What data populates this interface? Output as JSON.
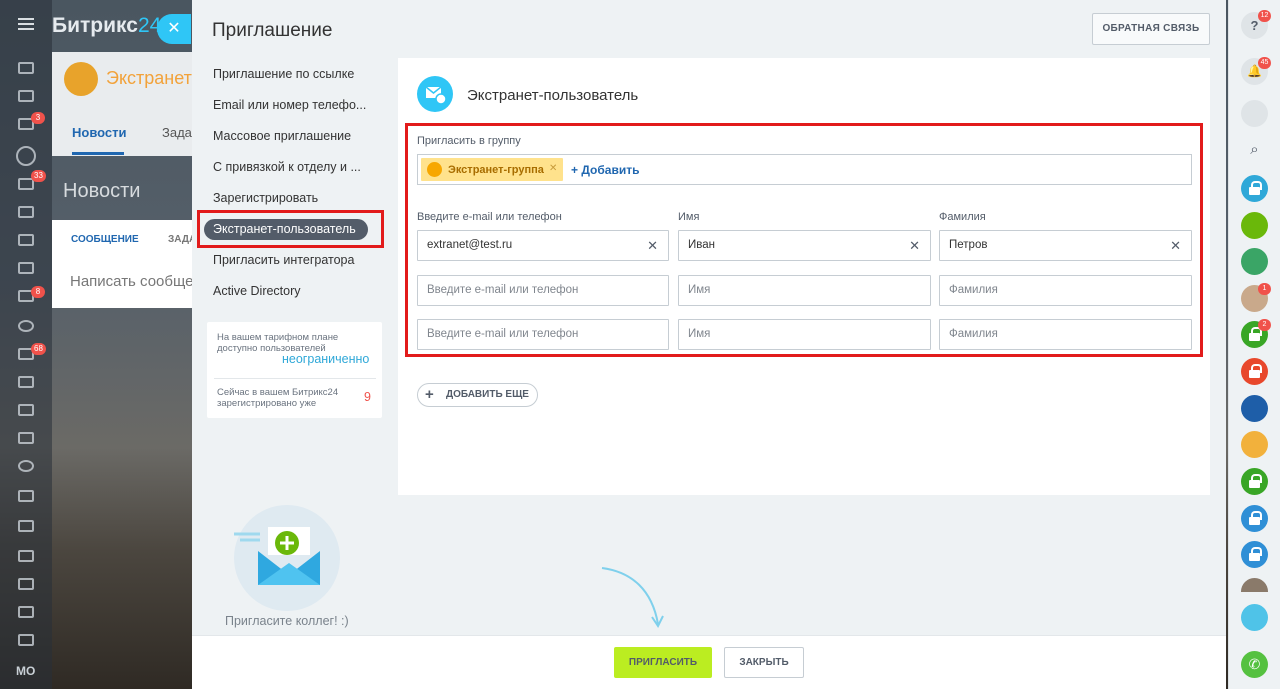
{
  "background": {
    "logo_main": "Битрикс",
    "logo_suffix": "24",
    "group_title": "Экстранет",
    "tabs": [
      "Новости",
      "Зада"
    ],
    "news_title": "Новости",
    "feed_tabs": [
      "СООБЩЕНИЕ",
      "ЗАДА"
    ],
    "write_placeholder": "Написать сообще",
    "bottom_initials": "МО",
    "left_badges": [
      "3",
      "33",
      "8",
      "68"
    ]
  },
  "right_sidebar": {
    "badges": [
      "12",
      "45",
      "1",
      "2"
    ]
  },
  "panel": {
    "title": "Приглашение",
    "feedback_button": "ОБРАТНАЯ СВЯЗЬ",
    "nav": [
      "Приглашение по ссылке",
      "Email или номер телефо...",
      "Массовое приглашение",
      "С привязкой к отделу и ...",
      "Зарегистрировать",
      "Экстранет-пользователь",
      "Пригласить интегратора",
      "Active Directory"
    ],
    "tariff": {
      "line1": "На вашем тарифном плане",
      "line2": "доступно пользователей",
      "value1": "неограниченно",
      "line3": "Сейчас в вашем Битрикс24",
      "line4": "зарегистрировано уже",
      "value2": "9"
    },
    "invite_colleagues": "Пригласите коллег! :)"
  },
  "card": {
    "title": "Экстранет-пользователь",
    "group_label": "Пригласить в группу",
    "group_chip": "Экстранет-группа",
    "add_link": "+ Добавить",
    "col_email": "Введите e-mail или телефон",
    "col_name": "Имя",
    "col_surname": "Фамилия",
    "rows": [
      {
        "email": "extranet@test.ru",
        "name": "Иван",
        "surname": "Петров"
      },
      {
        "email": "",
        "name": "",
        "surname": ""
      },
      {
        "email": "",
        "name": "",
        "surname": ""
      }
    ],
    "placeholders": {
      "email": "Введите e-mail или телефон",
      "name": "Имя",
      "surname": "Фамилия"
    },
    "add_more": "ДОБАВИТЬ ЕЩЕ"
  },
  "footer": {
    "invite_button": "ПРИГЛАСИТЬ",
    "close_button": "ЗАКРЫТЬ"
  },
  "colors": {
    "accent": "#2fc6f6",
    "invite_green": "#bbed21",
    "highlight_red": "#e21b1b",
    "link_blue": "#2067b0"
  }
}
